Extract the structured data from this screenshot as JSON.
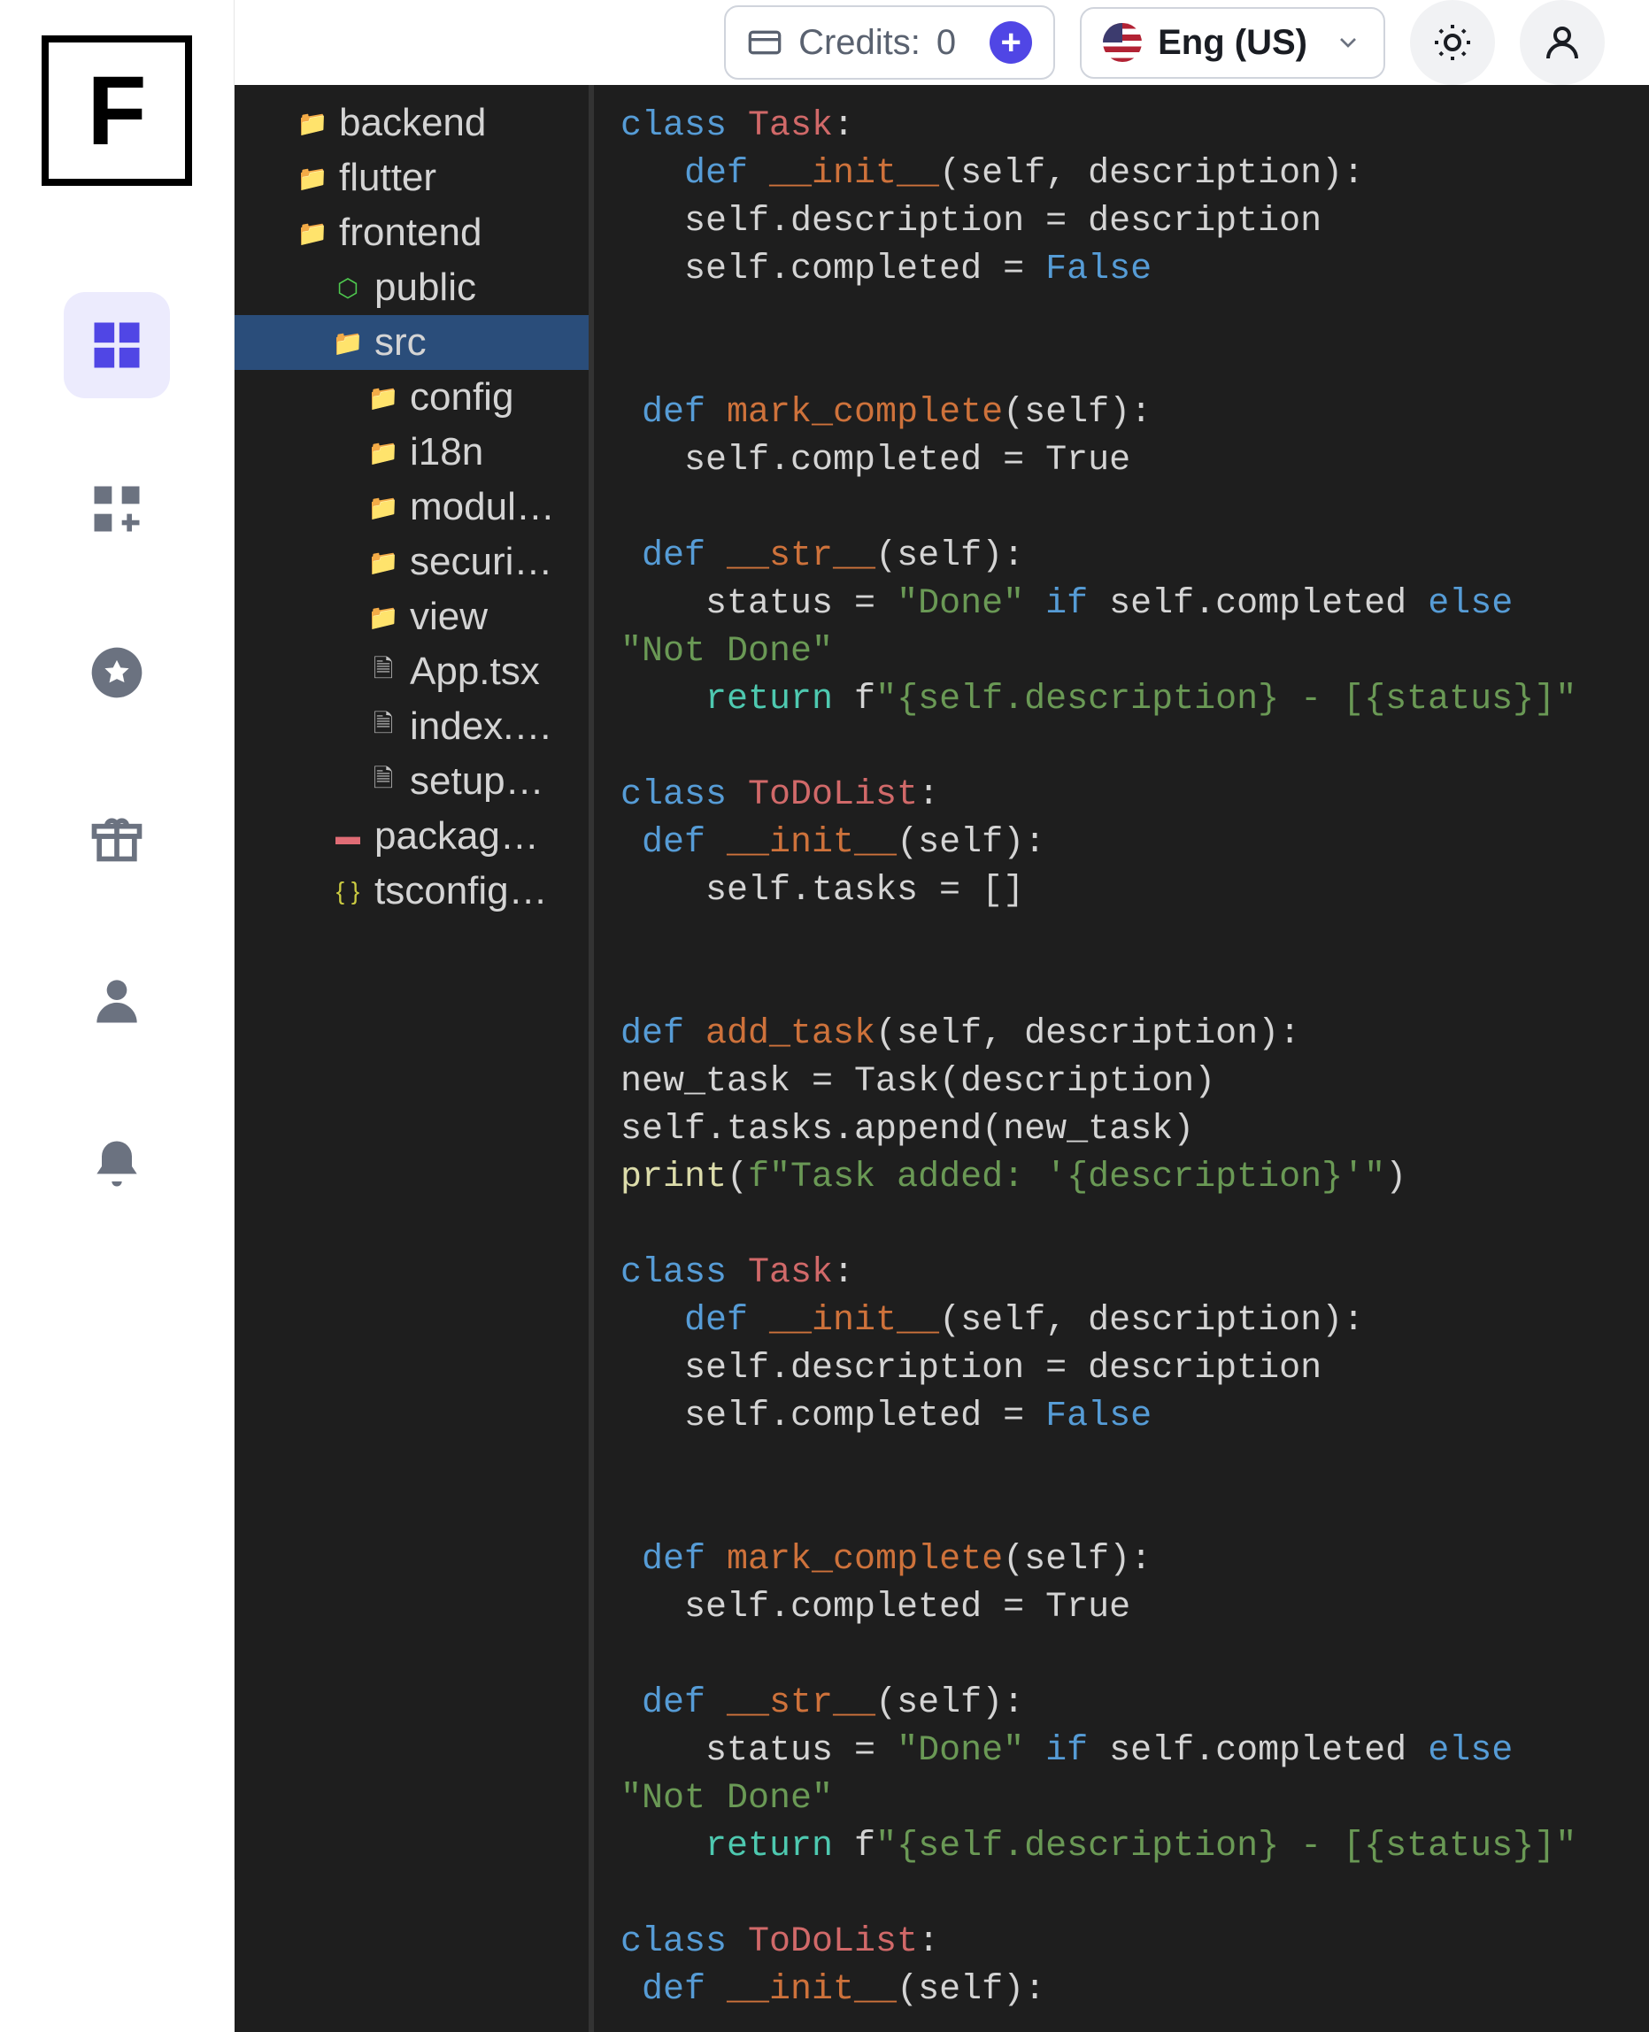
{
  "logo": "F",
  "topbar": {
    "credits_label": "Credits:",
    "credits_value": "0",
    "language": "Eng (US)"
  },
  "file_tree": [
    {
      "name": "backend",
      "icon": "folder",
      "indent": 1
    },
    {
      "name": "flutter",
      "icon": "folder",
      "indent": 1
    },
    {
      "name": "frontend",
      "icon": "folder",
      "indent": 1
    },
    {
      "name": "public",
      "icon": "public",
      "indent": 2
    },
    {
      "name": "src",
      "icon": "folder",
      "indent": 2,
      "selected": true
    },
    {
      "name": "config",
      "icon": "folder",
      "indent": 3
    },
    {
      "name": "i18n",
      "icon": "folder",
      "indent": 3
    },
    {
      "name": "modul…",
      "icon": "folder",
      "indent": 3
    },
    {
      "name": "securi…",
      "icon": "folder",
      "indent": 3
    },
    {
      "name": "view",
      "icon": "folder",
      "indent": 3
    },
    {
      "name": "App.tsx",
      "icon": "file",
      "indent": 3
    },
    {
      "name": "index.…",
      "icon": "file",
      "indent": 3
    },
    {
      "name": "setup…",
      "icon": "file",
      "indent": 3
    },
    {
      "name": "packag…",
      "icon": "error",
      "indent": 2
    },
    {
      "name": "tsconfig…",
      "icon": "json",
      "indent": 2
    }
  ],
  "code_lines": [
    [
      {
        "t": "class ",
        "c": "kw"
      },
      {
        "t": "Task",
        "c": "cls"
      },
      {
        "t": ":",
        "c": ""
      }
    ],
    [
      {
        "t": "   ",
        "c": ""
      },
      {
        "t": "def ",
        "c": "kw"
      },
      {
        "t": "__init__",
        "c": "fn"
      },
      {
        "t": "(self, description):",
        "c": ""
      }
    ],
    [
      {
        "t": "   self.description = description",
        "c": ""
      }
    ],
    [
      {
        "t": "   self.completed = ",
        "c": ""
      },
      {
        "t": "False",
        "c": "lit"
      }
    ],
    [
      {
        "t": "",
        "c": ""
      }
    ],
    [
      {
        "t": "",
        "c": ""
      }
    ],
    [
      {
        "t": " ",
        "c": ""
      },
      {
        "t": "def ",
        "c": "kw"
      },
      {
        "t": "mark_complete",
        "c": "fn"
      },
      {
        "t": "(self):",
        "c": ""
      }
    ],
    [
      {
        "t": "   self.completed = True",
        "c": ""
      }
    ],
    [
      {
        "t": "",
        "c": ""
      }
    ],
    [
      {
        "t": " ",
        "c": ""
      },
      {
        "t": "def ",
        "c": "kw"
      },
      {
        "t": "__str__",
        "c": "fn"
      },
      {
        "t": "(self):",
        "c": ""
      }
    ],
    [
      {
        "t": "    status = ",
        "c": ""
      },
      {
        "t": "\"Done\"",
        "c": "str"
      },
      {
        "t": " ",
        "c": ""
      },
      {
        "t": "if",
        "c": "kw"
      },
      {
        "t": " self.completed ",
        "c": ""
      },
      {
        "t": "else",
        "c": "kw"
      }
    ],
    [
      {
        "t": "\"Not Done\"",
        "c": "str"
      }
    ],
    [
      {
        "t": "    ",
        "c": ""
      },
      {
        "t": "return",
        "c": "ret"
      },
      {
        "t": " f",
        "c": ""
      },
      {
        "t": "\"{self.description} - [{status}]\"",
        "c": "str"
      }
    ],
    [
      {
        "t": "",
        "c": ""
      }
    ],
    [
      {
        "t": "class ",
        "c": "kw"
      },
      {
        "t": "ToDoList",
        "c": "cls"
      },
      {
        "t": ":",
        "c": ""
      }
    ],
    [
      {
        "t": " ",
        "c": ""
      },
      {
        "t": "def ",
        "c": "kw"
      },
      {
        "t": "__init__",
        "c": "fn"
      },
      {
        "t": "(self):",
        "c": ""
      }
    ],
    [
      {
        "t": "    self.tasks = []",
        "c": ""
      }
    ],
    [
      {
        "t": "",
        "c": ""
      }
    ],
    [
      {
        "t": "",
        "c": ""
      }
    ],
    [
      {
        "t": "def ",
        "c": "kw"
      },
      {
        "t": "add_task",
        "c": "fn"
      },
      {
        "t": "(self, description):",
        "c": ""
      }
    ],
    [
      {
        "t": "new_task = Task(description)",
        "c": ""
      }
    ],
    [
      {
        "t": "self.tasks.append(new_task)",
        "c": ""
      }
    ],
    [
      {
        "t": "print",
        "c": "print"
      },
      {
        "t": "(",
        "c": ""
      },
      {
        "t": "f\"Task added: '{description}'\"",
        "c": "str"
      },
      {
        "t": ")",
        "c": ""
      }
    ],
    [
      {
        "t": "",
        "c": ""
      }
    ],
    [
      {
        "t": "class ",
        "c": "kw"
      },
      {
        "t": "Task",
        "c": "cls"
      },
      {
        "t": ":",
        "c": ""
      }
    ],
    [
      {
        "t": "   ",
        "c": ""
      },
      {
        "t": "def ",
        "c": "kw"
      },
      {
        "t": "__init__",
        "c": "fn"
      },
      {
        "t": "(self, description):",
        "c": ""
      }
    ],
    [
      {
        "t": "   self.description = description",
        "c": ""
      }
    ],
    [
      {
        "t": "   self.completed = ",
        "c": ""
      },
      {
        "t": "False",
        "c": "lit"
      }
    ],
    [
      {
        "t": "",
        "c": ""
      }
    ],
    [
      {
        "t": "",
        "c": ""
      }
    ],
    [
      {
        "t": " ",
        "c": ""
      },
      {
        "t": "def ",
        "c": "kw"
      },
      {
        "t": "mark_complete",
        "c": "fn"
      },
      {
        "t": "(self):",
        "c": ""
      }
    ],
    [
      {
        "t": "   self.completed = True",
        "c": ""
      }
    ],
    [
      {
        "t": "",
        "c": ""
      }
    ],
    [
      {
        "t": " ",
        "c": ""
      },
      {
        "t": "def ",
        "c": "kw"
      },
      {
        "t": "__str__",
        "c": "fn"
      },
      {
        "t": "(self):",
        "c": ""
      }
    ],
    [
      {
        "t": "    status = ",
        "c": ""
      },
      {
        "t": "\"Done\"",
        "c": "str"
      },
      {
        "t": " ",
        "c": ""
      },
      {
        "t": "if",
        "c": "kw"
      },
      {
        "t": " self.completed ",
        "c": ""
      },
      {
        "t": "else",
        "c": "kw"
      }
    ],
    [
      {
        "t": "\"Not Done\"",
        "c": "str"
      }
    ],
    [
      {
        "t": "    ",
        "c": ""
      },
      {
        "t": "return",
        "c": "ret"
      },
      {
        "t": " f",
        "c": ""
      },
      {
        "t": "\"{self.description} - [{status}]\"",
        "c": "str"
      }
    ],
    [
      {
        "t": "",
        "c": ""
      }
    ],
    [
      {
        "t": "class ",
        "c": "kw"
      },
      {
        "t": "ToDoList",
        "c": "cls"
      },
      {
        "t": ":",
        "c": ""
      }
    ],
    [
      {
        "t": " ",
        "c": ""
      },
      {
        "t": "def ",
        "c": "kw"
      },
      {
        "t": "__init__",
        "c": "fn"
      },
      {
        "t": "(self):",
        "c": ""
      }
    ]
  ]
}
